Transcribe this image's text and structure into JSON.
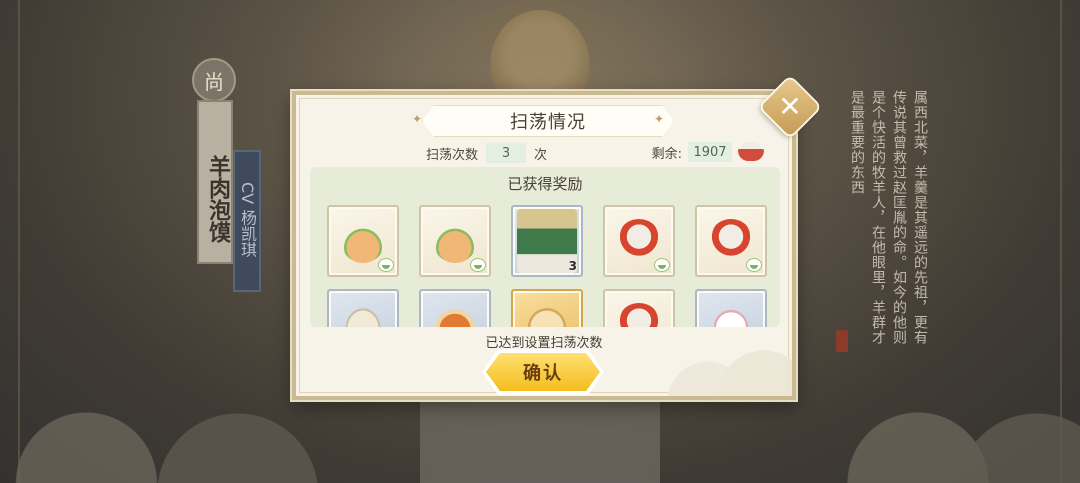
{
  "background": {
    "dish_badge": "尚",
    "dish_name": "羊肉泡馍",
    "cv_label": "CV 杨凯琪",
    "story_text": "属西北菜，羊羹是其遥远的先祖，更有传说其曾救过赵匡胤的命。如今的他则是个快活的牧羊人，在他眼里，羊群才是最重要的东西"
  },
  "dialog": {
    "title": "扫荡情况",
    "close_symbol": "✕",
    "sweep_label": "扫荡次数",
    "sweep_count": "3",
    "sweep_unit": "次",
    "remain_label": "剩余:",
    "remain_value": "1907",
    "remain_icon": "bowl-icon",
    "rewards_title": "已获得奖励",
    "rewards": [
      {
        "art": "soup-girl",
        "frame": "plain",
        "badge": "bowl",
        "qty": ""
      },
      {
        "art": "soup-girl",
        "frame": "plain",
        "badge": "bowl",
        "qty": ""
      },
      {
        "art": "character-card",
        "frame": "blue",
        "badge": "",
        "qty": "3"
      },
      {
        "art": "chef-pot",
        "frame": "plain",
        "badge": "bowl",
        "qty": ""
      },
      {
        "art": "chef-pot",
        "frame": "plain",
        "badge": "bowl",
        "qty": ""
      },
      {
        "art": "dumpling",
        "frame": "blue",
        "badge": "",
        "qty": ""
      },
      {
        "art": "girl-food",
        "frame": "blue",
        "badge": "",
        "qty": ""
      },
      {
        "art": "bun",
        "frame": "gold",
        "badge": "",
        "qty": ""
      },
      {
        "art": "chef-fire",
        "frame": "plain",
        "badge": "fire",
        "qty": ""
      },
      {
        "art": "fox",
        "frame": "blue",
        "badge": "",
        "qty": ""
      }
    ],
    "status_text": "已达到设置扫荡次数",
    "confirm_label": "确认"
  },
  "colors": {
    "confirm_button": "#f3bd1e",
    "value_box": "#e4efe3",
    "rewards_panel": "#e6ecd7"
  }
}
